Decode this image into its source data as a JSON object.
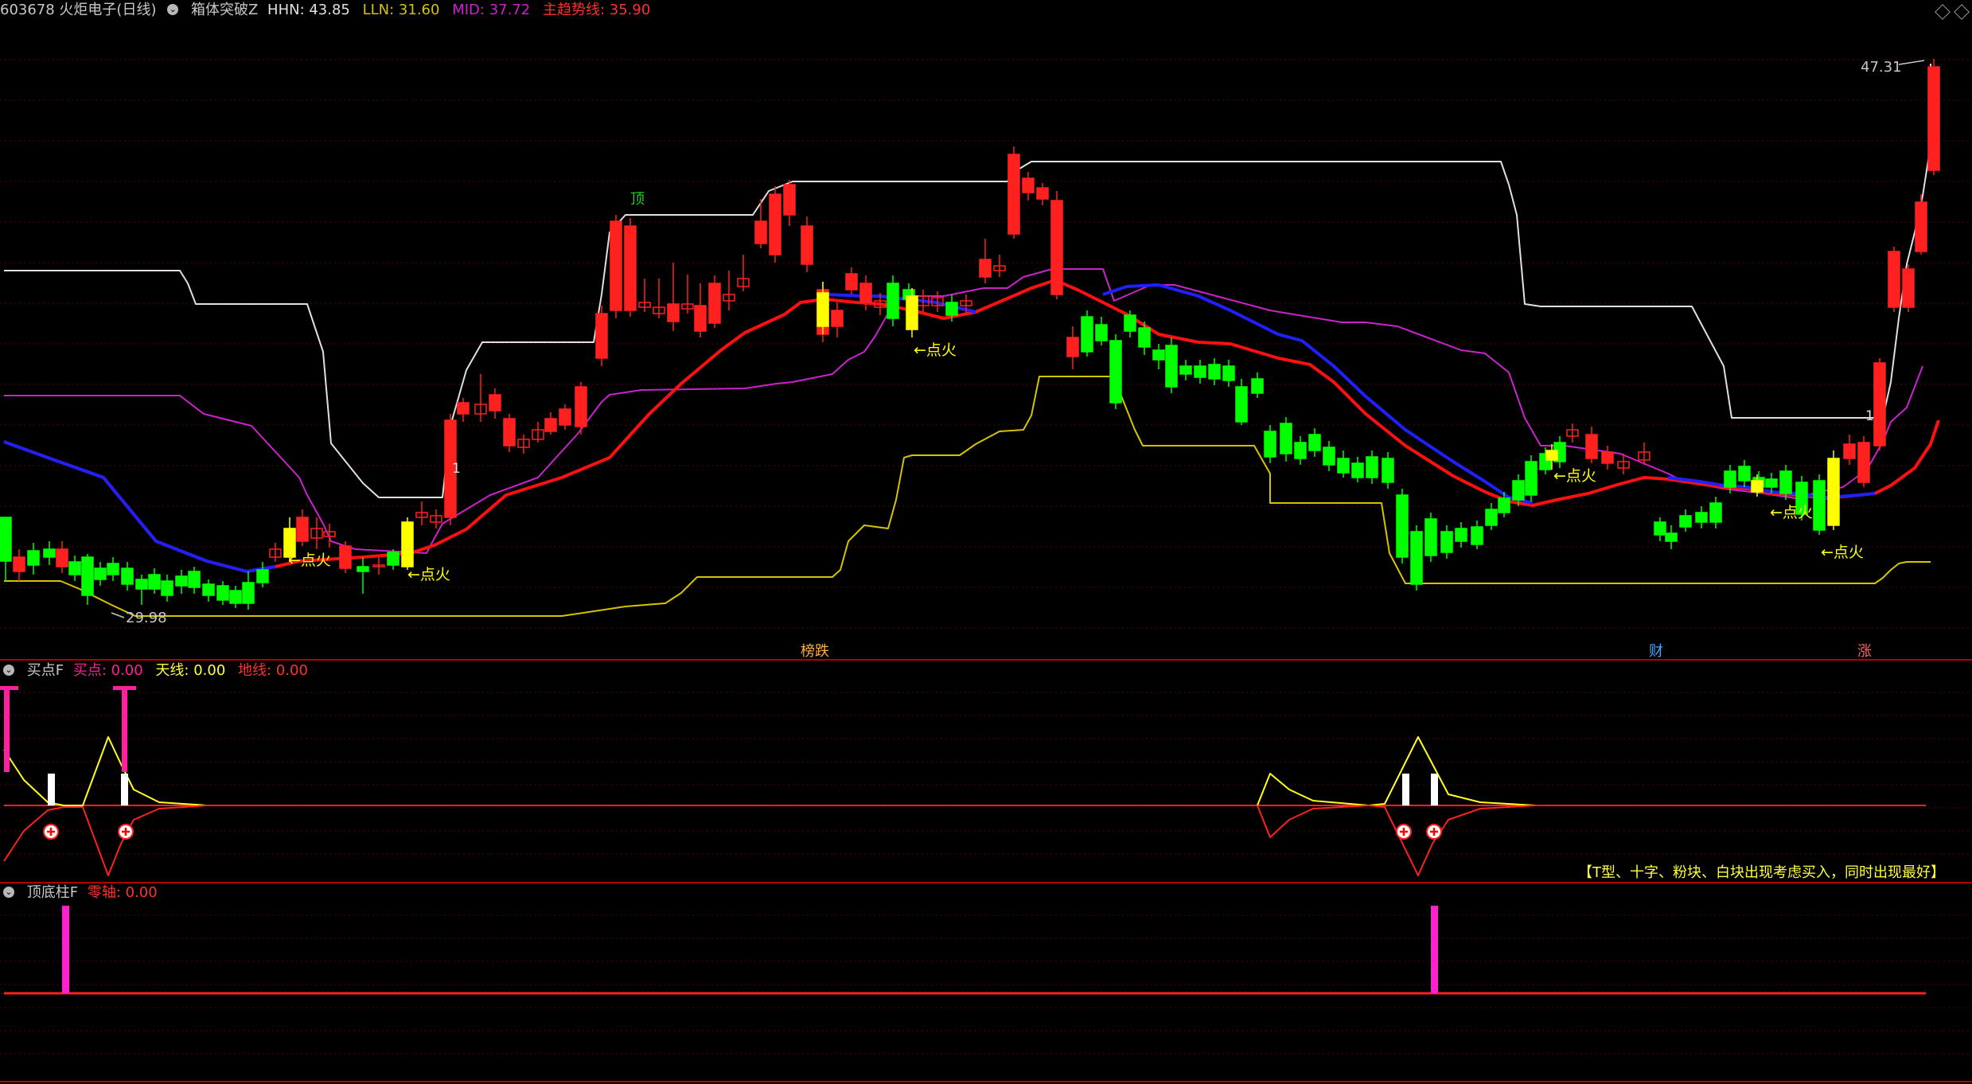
{
  "main": {
    "code_name": "603678 火炬电子(日线)",
    "indicator": "箱体突破Z",
    "hhn": "HHN: 43.85",
    "lln": "LLN: 31.60",
    "mid": "MID: 37.72",
    "trend": "主趋势线: 35.90",
    "high_label": "47.31",
    "low_label": "29.98",
    "top_mark": "顶",
    "fire_label": "←点火",
    "one_label": "1",
    "events": [
      "榜跌",
      "财",
      "涨"
    ]
  },
  "sub1": {
    "name": "买点F",
    "buy": "买点: 0.00",
    "sky": "天线: 0.00",
    "ground": "地线: 0.00",
    "note": "【T型、十字、粉块、白块出现考虑买入，同时出现最好】"
  },
  "sub2": {
    "name": "顶底柱F",
    "zero": "零轴: 0.00"
  },
  "colors": {
    "up": "#ff2020",
    "down": "#00ff00",
    "fire": "#ffff00",
    "trend": "#ff1010",
    "mid": "#2020ff",
    "hhn": "#e0e0e0",
    "lln": "#d4c400",
    "band": "#cc22cc",
    "pillar": "#ff20d0"
  }
}
